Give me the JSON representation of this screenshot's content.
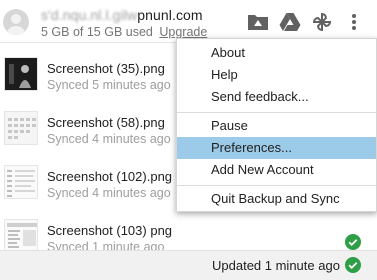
{
  "header": {
    "email_masked": "s'd.nqu.nl.l.gilw",
    "email_visible": "pnunl.com",
    "storage_text": "5 GB of 15 GB used",
    "upgrade_label": "Upgrade"
  },
  "files": [
    {
      "name": "Screenshot (35).png",
      "status": "Synced 5 minutes ago"
    },
    {
      "name": "Screenshot (58).png",
      "status": "Synced 4 minutes ago"
    },
    {
      "name": "Screenshot (102).png",
      "status": "Synced 4 minutes ago"
    },
    {
      "name": "Screenshot (103) png",
      "status": "Synced 1 minute ago"
    }
  ],
  "menu": {
    "about": "About",
    "help": "Help",
    "send_feedback": "Send feedback...",
    "pause": "Pause",
    "preferences": "Preferences...",
    "add_account": "Add New Account",
    "quit": "Quit Backup and Sync"
  },
  "footer": {
    "status": "Updated 1 minute ago"
  },
  "colors": {
    "check_green": "#2e9e47",
    "menu_highlight": "#9ccbea",
    "icon_gray": "#616161"
  }
}
